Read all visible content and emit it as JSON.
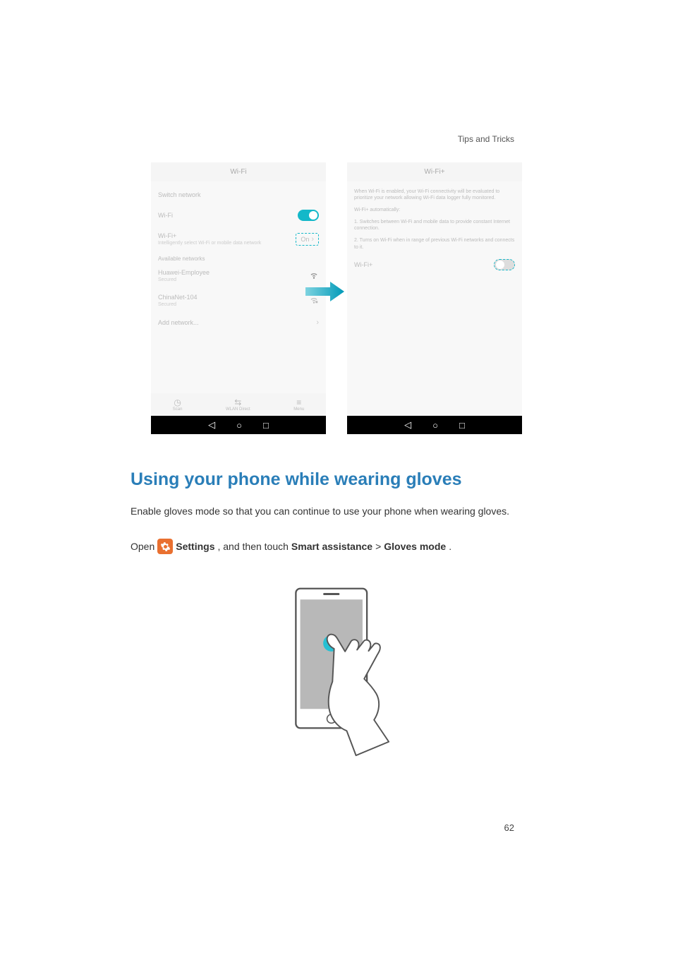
{
  "header": {
    "section": "Tips and Tricks"
  },
  "screenshot_left": {
    "title": "Wi-Fi",
    "switch_label": "Switch network",
    "wifi_label": "Wi-Fi",
    "wifi_plus": "Wi-Fi+",
    "wifi_plus_desc": "Intelligently select Wi-Fi or mobile data network",
    "wifi_plus_badge": "On",
    "avail_label": "Available networks",
    "network1": "Huawei-Employee",
    "network1_sub": "Secured",
    "network2": "ChinaNet-104",
    "network2_sub": "Secured",
    "add_network": "Add network...",
    "tab1": "Scan",
    "tab2": "WLAN Direct",
    "tab3": "Menu"
  },
  "screenshot_right": {
    "title": "Wi-Fi+",
    "info_line1": "When Wi-Fi is enabled, your Wi-Fi connectivity will be evaluated to prioritize your network allowing Wi-Fi data logger fully monitored.",
    "info_line2": "Wi-Fi+ automatically:",
    "info_line3": "1. Switches between Wi-Fi and mobile data to provide constant Internet connection.",
    "info_line4": "2. Turns on Wi-Fi when in range of previous Wi-Fi networks and connects to it.",
    "toggle_label": "Wi-Fi+"
  },
  "heading": "Using your phone while wearing gloves",
  "paragraph": "Enable gloves mode so that you can continue to use your phone when wearing gloves.",
  "instruction": {
    "open": "Open",
    "settings": "Settings",
    "middle": ", and then touch",
    "smart_assistance": "Smart assistance",
    "gt": ">",
    "gloves_mode": "Gloves mode",
    "end": "."
  },
  "page_number": "62"
}
